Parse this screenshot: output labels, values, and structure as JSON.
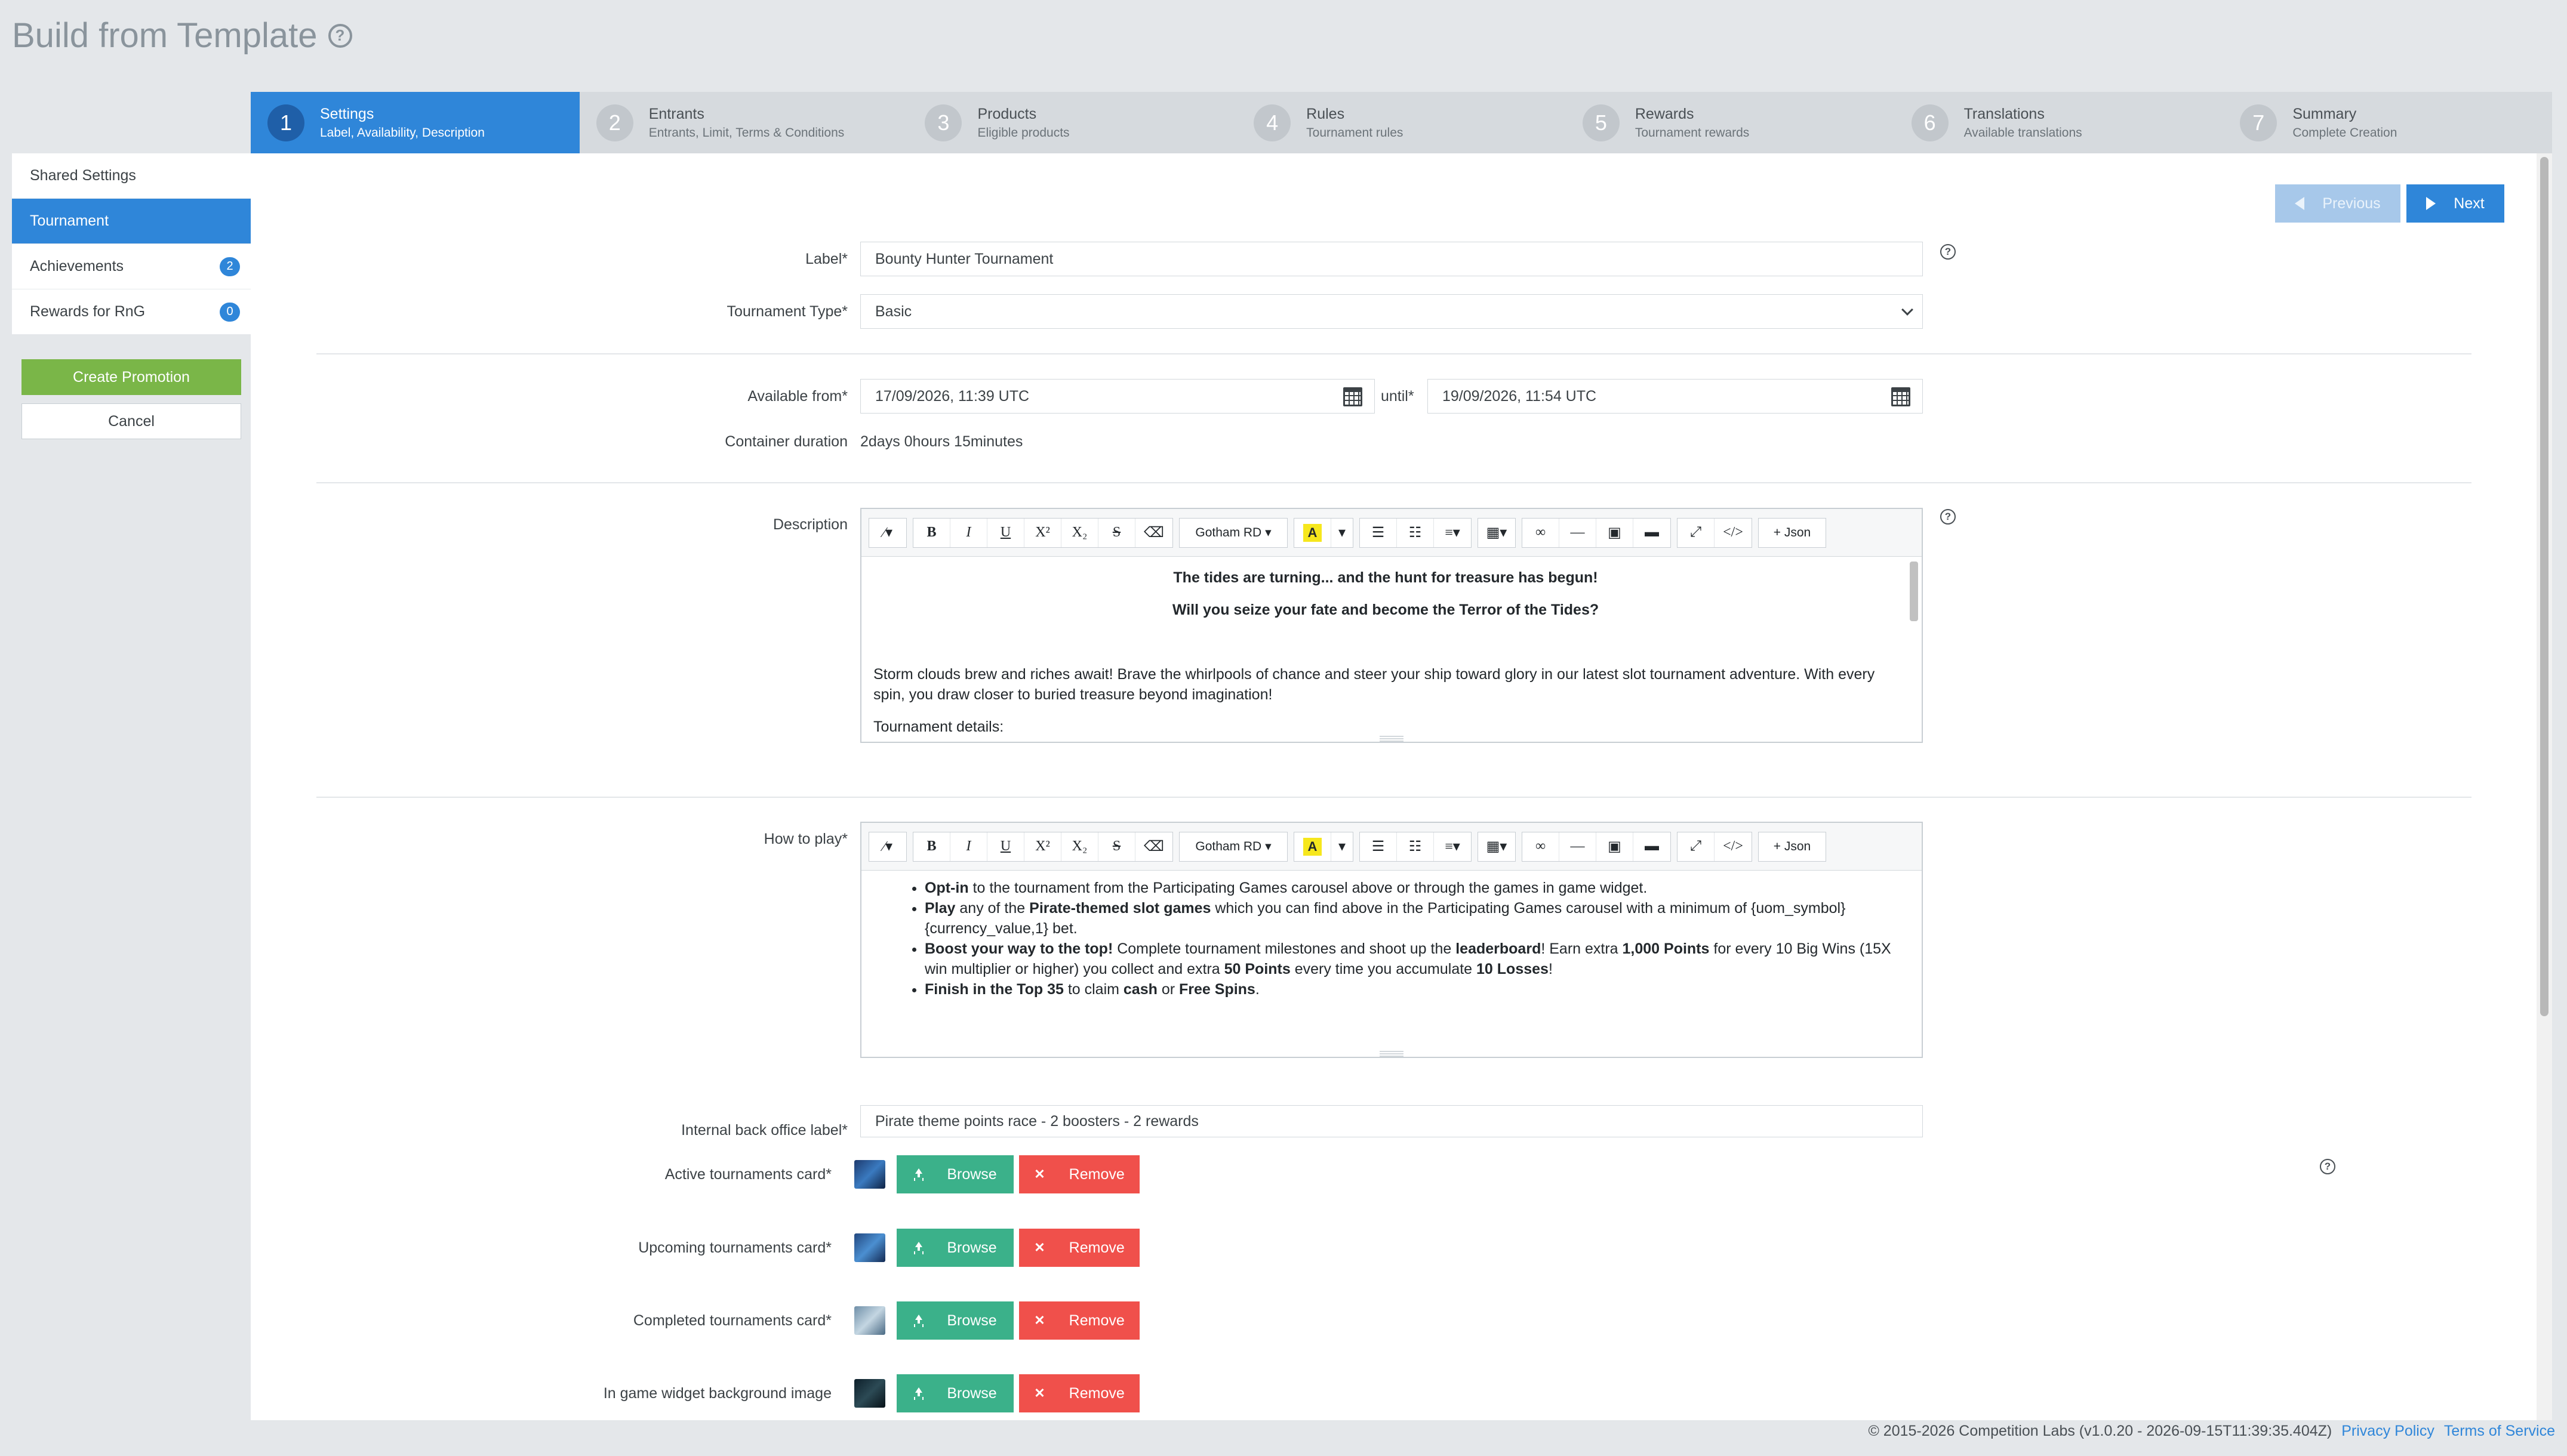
{
  "page": {
    "title": "Build from Template"
  },
  "stepper": [
    {
      "num": "1",
      "title": "Settings",
      "sub": "Label, Availability, Description"
    },
    {
      "num": "2",
      "title": "Entrants",
      "sub": "Entrants, Limit, Terms & Conditions"
    },
    {
      "num": "3",
      "title": "Products",
      "sub": "Eligible products"
    },
    {
      "num": "4",
      "title": "Rules",
      "sub": "Tournament rules"
    },
    {
      "num": "5",
      "title": "Rewards",
      "sub": "Tournament rewards"
    },
    {
      "num": "6",
      "title": "Translations",
      "sub": "Available translations"
    },
    {
      "num": "7",
      "title": "Summary",
      "sub": "Complete Creation"
    }
  ],
  "sidebar": {
    "items": [
      {
        "label": "Shared Settings",
        "badge": ""
      },
      {
        "label": "Tournament",
        "badge": ""
      },
      {
        "label": "Achievements",
        "badge": "2"
      },
      {
        "label": "Rewards for RnG",
        "badge": "0"
      }
    ],
    "create_label": "Create Promotion",
    "cancel_label": "Cancel"
  },
  "nav": {
    "previous": "Previous",
    "next": "Next"
  },
  "form": {
    "label_label": "Label*",
    "label_value": "Bounty Hunter Tournament",
    "type_label": "Tournament Type*",
    "type_value": "Basic",
    "from_label": "Available from*",
    "from_value": "17/09/2026, 11:39 UTC",
    "until_label": "until*",
    "until_value": "19/09/2026, 11:54 UTC",
    "duration_label": "Container duration",
    "duration_value": "2days 0hours 15minutes",
    "description_label": "Description",
    "how_label": "How to play*",
    "internal_label": "Internal back office label*",
    "internal_value": "Pirate theme points race - 2 boosters - 2 rewards"
  },
  "toolbar": {
    "font": "Gotham RD",
    "json": "Json"
  },
  "description": {
    "line1": "The tides are turning... and the hunt for treasure has begun!",
    "line2": "Will you seize your fate and become the Terror of the Tides?",
    "para": "Storm clouds brew and riches await! Brave the whirlpools of chance and steer your ship toward glory in our latest slot tournament adventure. With every spin, you draw closer to buried treasure beyond imagination!",
    "details": "Tournament details:"
  },
  "howto": {
    "b1_bold": "Opt-in",
    "b1_text": " to the tournament from the Participating Games carousel above or through the games in game widget.",
    "b2_bold1": "Play",
    "b2_text1": " any of the ",
    "b2_bold2": "Pirate-themed slot games",
    "b2_text2": " which you can find above in the Participating Games carousel with a minimum of {uom_symbol}{currency_value,1} bet.",
    "b3_bold1": "Boost your way to the top!",
    "b3_text1": " Complete tournament milestones and shoot up the ",
    "b3_bold2": "leaderboard",
    "b3_text2": "! Earn extra ",
    "b3_bold3": "1,000 Points",
    "b3_text3": " for every 10 Big Wins (15X win multiplier or higher) you collect and extra ",
    "b3_bold4": "50 Points",
    "b3_text4": " every time you accumulate ",
    "b3_bold5": "10 Losses",
    "b3_text5": "!",
    "b4_bold1": "Finish in the Top 35",
    "b4_text1": " to claim ",
    "b4_bold2": "cash",
    "b4_text2": " or ",
    "b4_bold3": "Free Spins",
    "b4_text3": "."
  },
  "images": [
    {
      "label": "Active tournaments card*",
      "browse": "Browse",
      "remove": "Remove"
    },
    {
      "label": "Upcoming tournaments card*",
      "browse": "Browse",
      "remove": "Remove"
    },
    {
      "label": "Completed tournaments card*",
      "browse": "Browse",
      "remove": "Remove"
    },
    {
      "label": "In game widget background image",
      "browse": "Browse",
      "remove": "Remove"
    }
  ],
  "footer": {
    "copyright": "© 2015-2026 Competition Labs (v1.0.20 - 2026-09-15T11:39:35.404Z)",
    "privacy": "Privacy Policy",
    "terms": "Terms of Service"
  },
  "colors": {
    "primary": "#2f86d9",
    "success": "#7ab648",
    "browse": "#3bb18a",
    "remove": "#f0504b"
  }
}
